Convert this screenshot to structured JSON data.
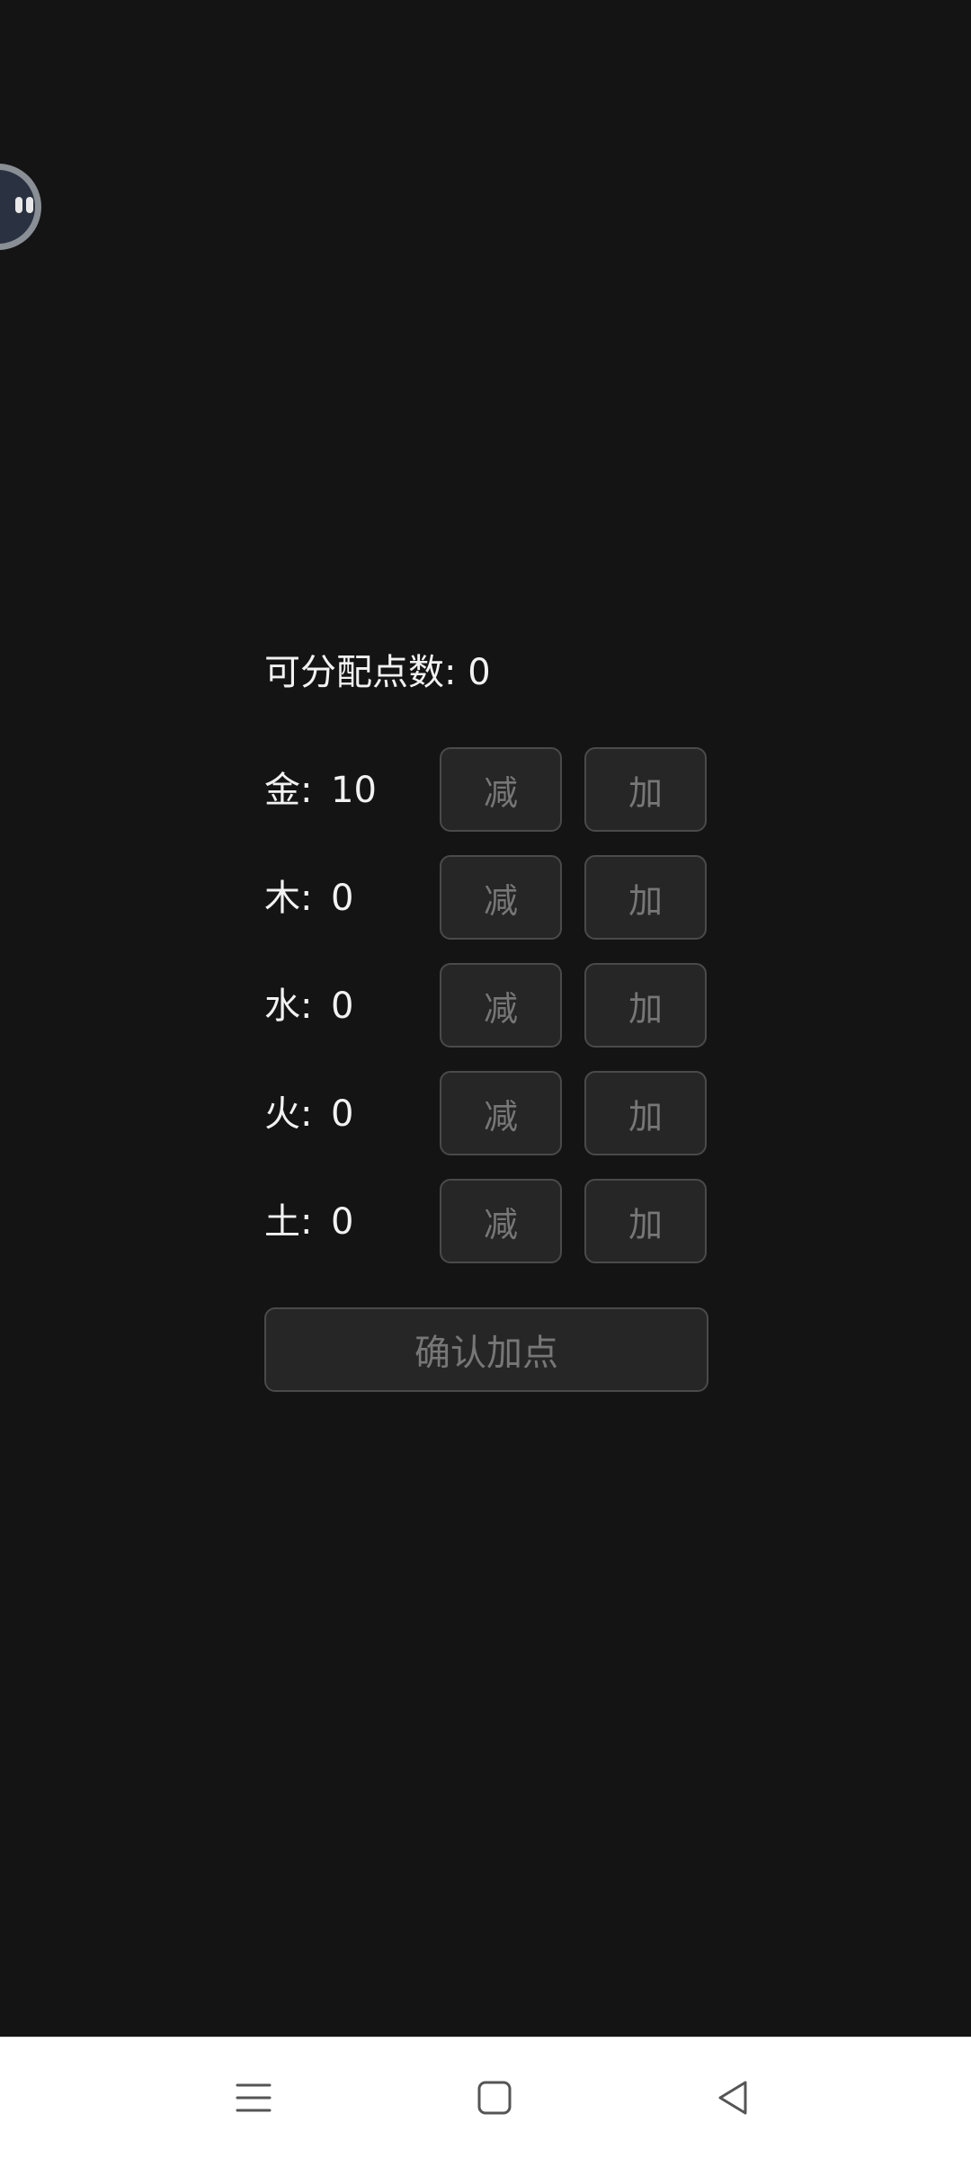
{
  "points": {
    "label": "可分配点数: 0"
  },
  "attributes": [
    {
      "name": "金:",
      "value": "10",
      "minus_label": "减",
      "plus_label": "加"
    },
    {
      "name": "木:",
      "value": "0",
      "minus_label": "减",
      "plus_label": "加"
    },
    {
      "name": "水:",
      "value": "0",
      "minus_label": "减",
      "plus_label": "加"
    },
    {
      "name": "火:",
      "value": "0",
      "minus_label": "减",
      "plus_label": "加"
    },
    {
      "name": "土:",
      "value": "0",
      "minus_label": "减",
      "plus_label": "加"
    }
  ],
  "confirm": {
    "label": "确认加点"
  },
  "icons": {
    "float_bubble": "assistant-bubble-icon",
    "nav_menu": "menu-icon",
    "nav_home": "home-square-icon",
    "nav_back": "back-triangle-icon"
  },
  "colors": {
    "background": "#141414",
    "text": "#f2f2f2",
    "button_disabled_text": "#777777",
    "button_border": "#4a4a4a",
    "nav_bar": "#ffffff"
  }
}
